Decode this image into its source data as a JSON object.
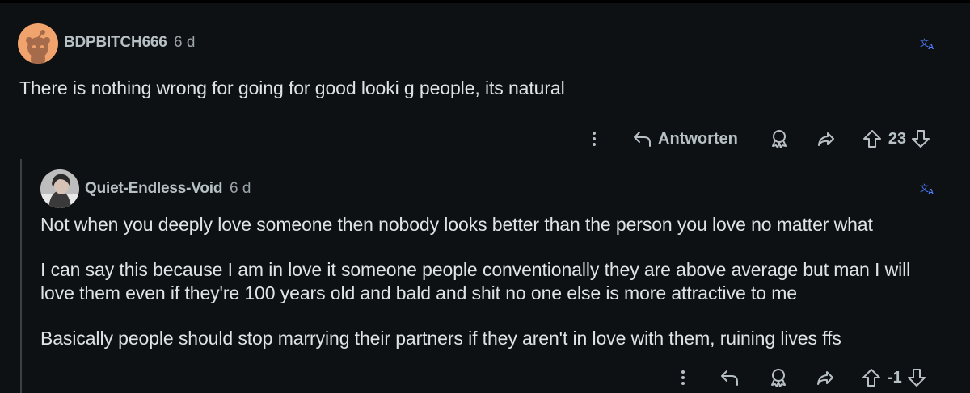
{
  "comment1": {
    "username": "BDPBITCH666",
    "time": "6 d",
    "text": "There is nothing wrong for going for good looki g people, its natural",
    "actions": {
      "reply_label": "Antworten",
      "score": "23"
    }
  },
  "comment2": {
    "username": "Quiet-Endless-Void",
    "time": "6 d",
    "paragraphs": [
      "Not when you deeply love someone then nobody looks better than the person you love no matter what",
      "I can say this because I am in love it someone people conventionally they are above average but man I will love them even if they're 100 years old and bald and shit no one else is more attractive to me",
      "Basically people should stop marrying their partners if they aren't in love with them, ruining lives ffs"
    ],
    "actions": {
      "score": "-1"
    }
  },
  "colors": {
    "background": "#0e1113",
    "text": "#dfe3e5",
    "muted": "#b7c0c5",
    "accent": "#4f7cff",
    "avatar_bg": "#f0a36c"
  },
  "icons": [
    "snoo-avatar",
    "translate-icon",
    "more-icon",
    "reply-icon",
    "award-icon",
    "share-icon",
    "upvote-icon",
    "downvote-icon"
  ]
}
